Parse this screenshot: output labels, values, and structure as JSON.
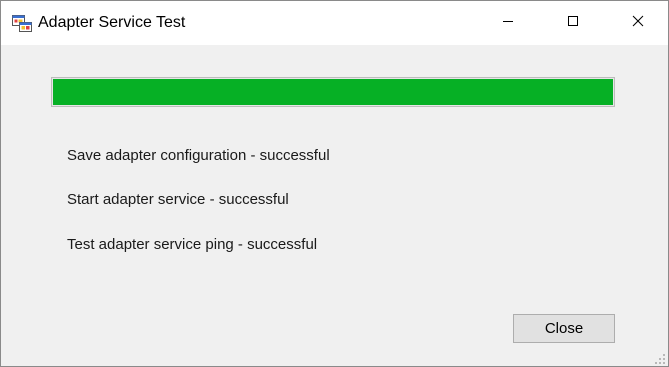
{
  "window": {
    "title": "Adapter Service Test",
    "icon": "app-window-icon"
  },
  "titlebar_controls": [
    {
      "name": "minimize",
      "icon": "minimize-icon"
    },
    {
      "name": "maximize",
      "icon": "maximize-icon"
    },
    {
      "name": "close",
      "icon": "close-icon"
    }
  ],
  "progress": {
    "value_percent": 100,
    "color": "#06b025"
  },
  "status_lines": [
    "Save adapter configuration - successful",
    "Start adapter service - successful",
    "Test adapter service ping - successful"
  ],
  "buttons": {
    "close_label": "Close"
  },
  "colors": {
    "window_background": "#f0f0f0",
    "titlebar_background": "#ffffff",
    "progress_green": "#06b025"
  }
}
